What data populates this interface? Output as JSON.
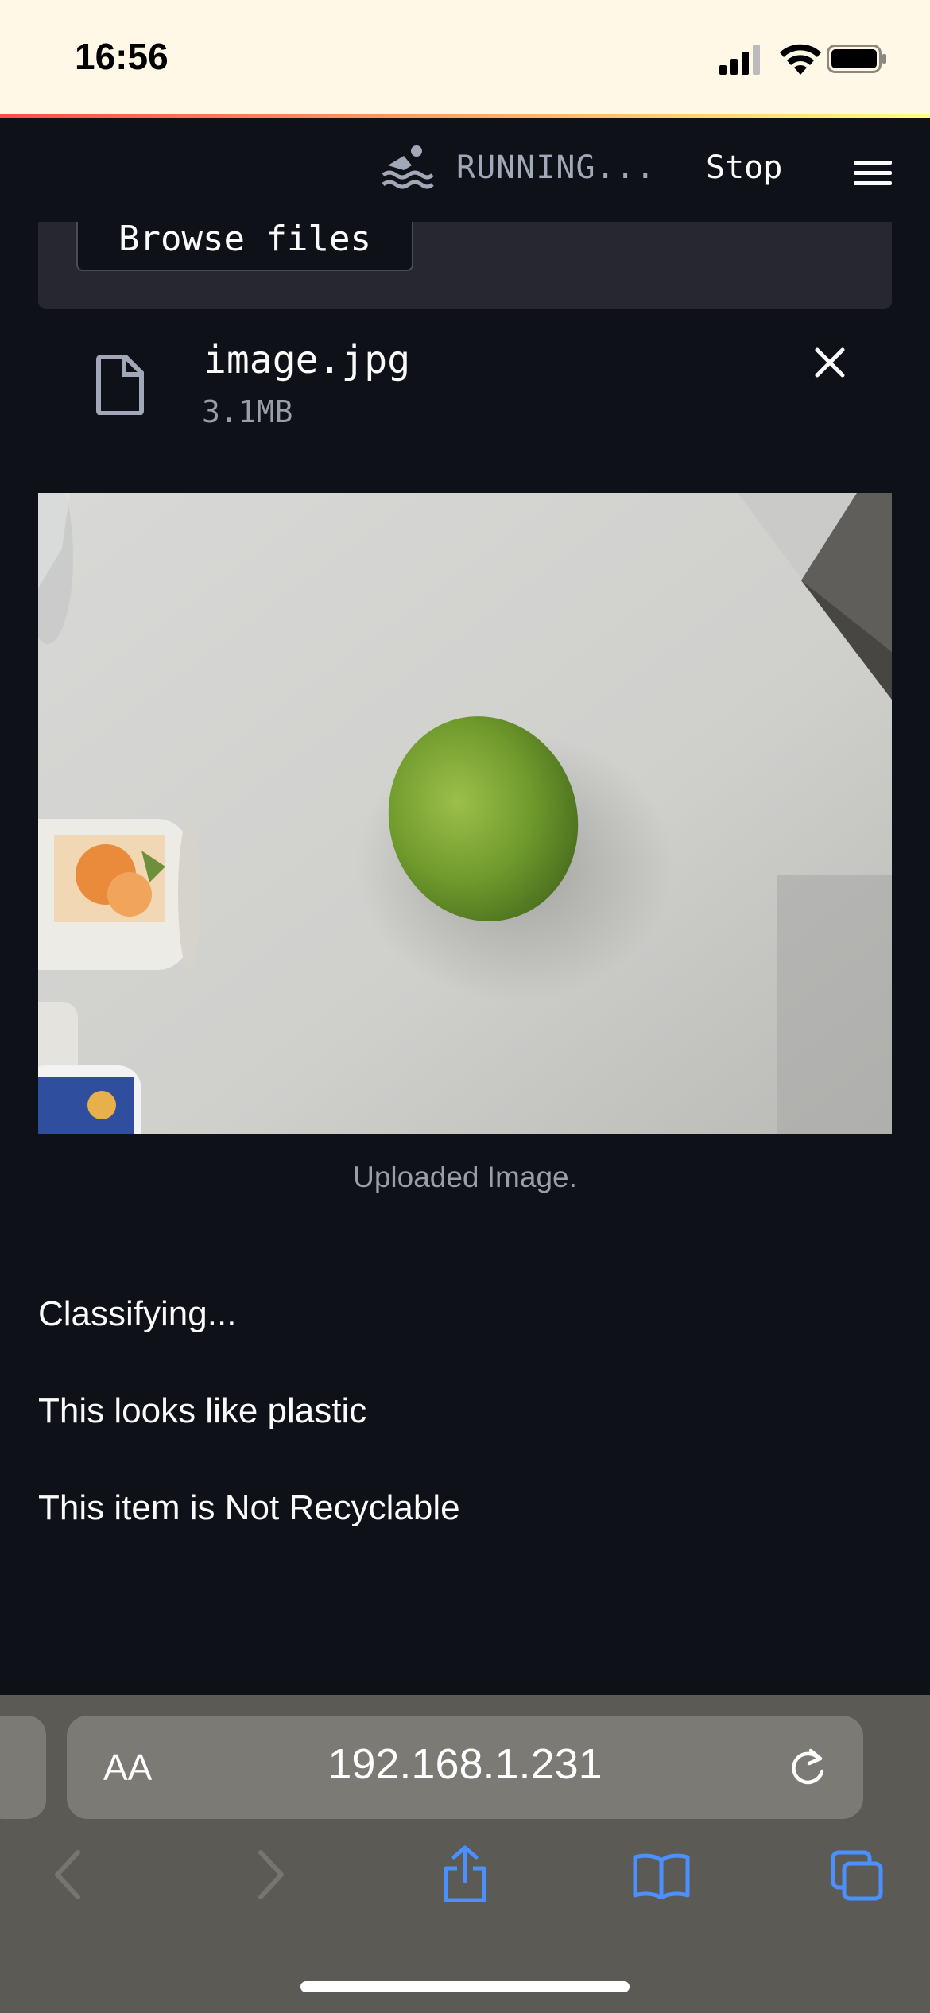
{
  "status_bar": {
    "time": "16:56"
  },
  "header": {
    "status": "RUNNING...",
    "stop_label": "Stop"
  },
  "uploader": {
    "browse_label": "Browse files"
  },
  "file": {
    "name": "image.jpg",
    "size": "3.1MB"
  },
  "image": {
    "caption": "Uploaded Image."
  },
  "messages": [
    "Classifying...",
    "This looks like plastic",
    "This item is Not Recyclable"
  ],
  "browser": {
    "text_size_label": "AA",
    "url": "192.168.1.231"
  },
  "colors": {
    "background": "#0e1117",
    "secondary_bg": "#262730",
    "accent_link": "#4a90ff"
  }
}
